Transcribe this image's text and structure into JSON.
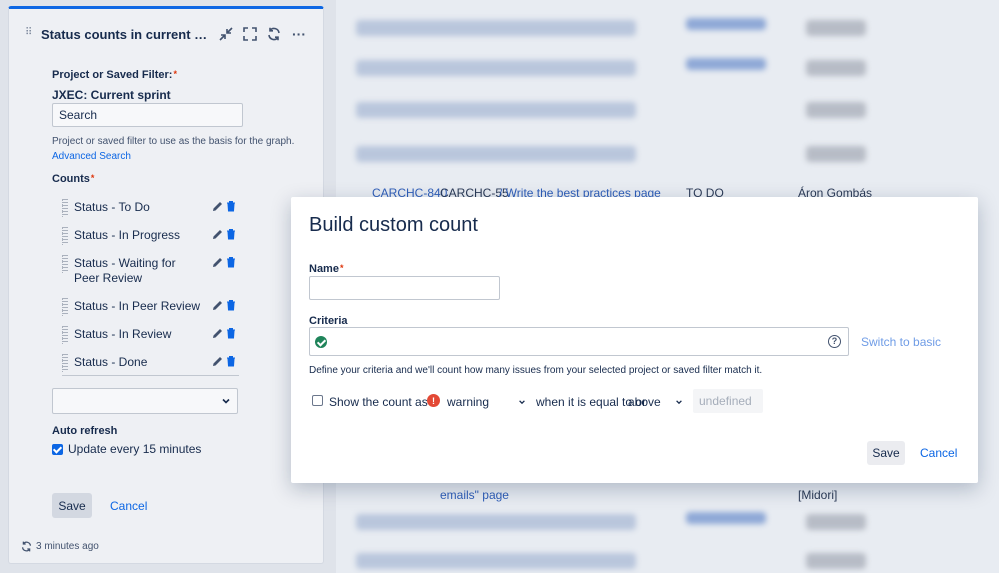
{
  "background": {
    "row1": {
      "key": "CARCHC-840",
      "parent": "CARCHC-55",
      "summary": "/ Write the best practices page",
      "status": "TO DO",
      "assignee": "Áron Gombás"
    },
    "row2": {
      "summary": "emails\" page",
      "assignee": "[Midori]"
    }
  },
  "gadget": {
    "title": "Status counts in current sprint",
    "filter_label": "Project or Saved Filter:",
    "filter_value": "JXEC: Current sprint",
    "search_value": "Search",
    "filter_help": "Project or saved filter to use as the basis for the graph.",
    "advanced_search": "Advanced Search",
    "counts_label": "Counts",
    "counts": [
      {
        "label": "Status - To Do"
      },
      {
        "label": "Status - In Progress"
      },
      {
        "label": "Status - Waiting for Peer Review"
      },
      {
        "label": "Status - In Peer Review"
      },
      {
        "label": "Status - In Review"
      },
      {
        "label": "Status - Done"
      }
    ],
    "auto_refresh_label": "Auto refresh",
    "auto_refresh_option": "Update every 15 minutes",
    "auto_refresh_checked": true,
    "save": "Save",
    "cancel": "Cancel",
    "last_updated": "3 minutes ago"
  },
  "modal": {
    "title": "Build custom count",
    "name_label": "Name",
    "name_value": "",
    "criteria_label": "Criteria",
    "criteria_value": "",
    "switch_basic": "Switch to basic",
    "criteria_help": "Define your criteria and we'll count how many issues from your selected project or saved filter match it.",
    "show_count_label": "Show the count as",
    "show_count_checked": false,
    "level": "warning",
    "condition_text": "when it is equal to or",
    "comparator": "above",
    "threshold_placeholder": "undefined",
    "save": "Save",
    "cancel": "Cancel"
  },
  "colors": {
    "accent": "#0c66e4",
    "warning": "#e34935",
    "success": "#1f845a",
    "required": "#de350b"
  }
}
